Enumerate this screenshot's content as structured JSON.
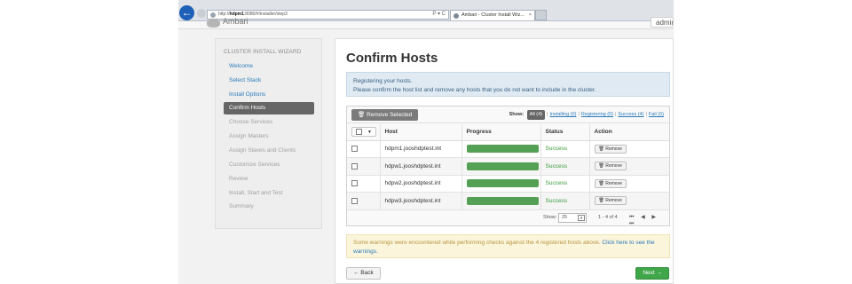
{
  "browser": {
    "address_prefix": "http://",
    "address_host": "hdpm1",
    "address_rest": ":8080/#/installer/step3",
    "address_tools": "P ▾ C",
    "tab_title": "Ambari - Cluster Install Wiz...",
    "tab_close": "×"
  },
  "app": {
    "brand": "Ambari",
    "user_label": "admin"
  },
  "wizard": {
    "title": "CLUSTER INSTALL WIZARD",
    "items": [
      {
        "label": "Welcome",
        "state": "link"
      },
      {
        "label": "Select Stack",
        "state": "link"
      },
      {
        "label": "Install Options",
        "state": "link"
      },
      {
        "label": "Confirm Hosts",
        "state": "active"
      },
      {
        "label": "Choose Services",
        "state": "disabled"
      },
      {
        "label": "Assign Masters",
        "state": "disabled"
      },
      {
        "label": "Assign Slaves and Clients",
        "state": "disabled"
      },
      {
        "label": "Customize Services",
        "state": "disabled"
      },
      {
        "label": "Review",
        "state": "disabled"
      },
      {
        "label": "Install, Start and Test",
        "state": "disabled"
      },
      {
        "label": "Summary",
        "state": "disabled"
      }
    ]
  },
  "main": {
    "title": "Confirm Hosts",
    "info_line1": "Registering your hosts.",
    "info_line2": "Please confirm the host list and remove any hosts that you do not want to include in the cluster.",
    "remove_selected": "Remove Selected",
    "filters": {
      "show_label": "Show:",
      "all": "All (4)",
      "installing": "Installing (0)",
      "registering": "Registering (0)",
      "success": "Success (4)",
      "fail": "Fail (0)"
    },
    "columns": {
      "host": "Host",
      "progress": "Progress",
      "status": "Status",
      "action": "Action"
    },
    "hosts": [
      {
        "host": "hdpm1.jooshdptest.int",
        "progress": 1.0,
        "status": "Success",
        "action": "Remove"
      },
      {
        "host": "hdpw1.jooshdptest.int",
        "progress": 1.0,
        "status": "Success",
        "action": "Remove"
      },
      {
        "host": "hdpw2.jooshdptest.int",
        "progress": 1.0,
        "status": "Success",
        "action": "Remove"
      },
      {
        "host": "hdpw3.jooshdptest.int",
        "progress": 1.0,
        "status": "Success",
        "action": "Remove"
      }
    ],
    "pager": {
      "show_label": "Show:",
      "page_size": "25",
      "range": "1 - 4 of 4",
      "nav": "⏮ ◀ ▶ ⏭"
    },
    "warning_text": "Some warnings were encountered while performing checks against the 4 registered hosts above.",
    "warning_link": "Click here to see the warnings.",
    "back_button": "← Back",
    "next_button": "Next →"
  },
  "colors": {
    "success": "#3d9a3d",
    "progress": "#5aa35a",
    "link": "#2b7bb9",
    "next": "#3fa64a",
    "active_nav": "#666666"
  }
}
